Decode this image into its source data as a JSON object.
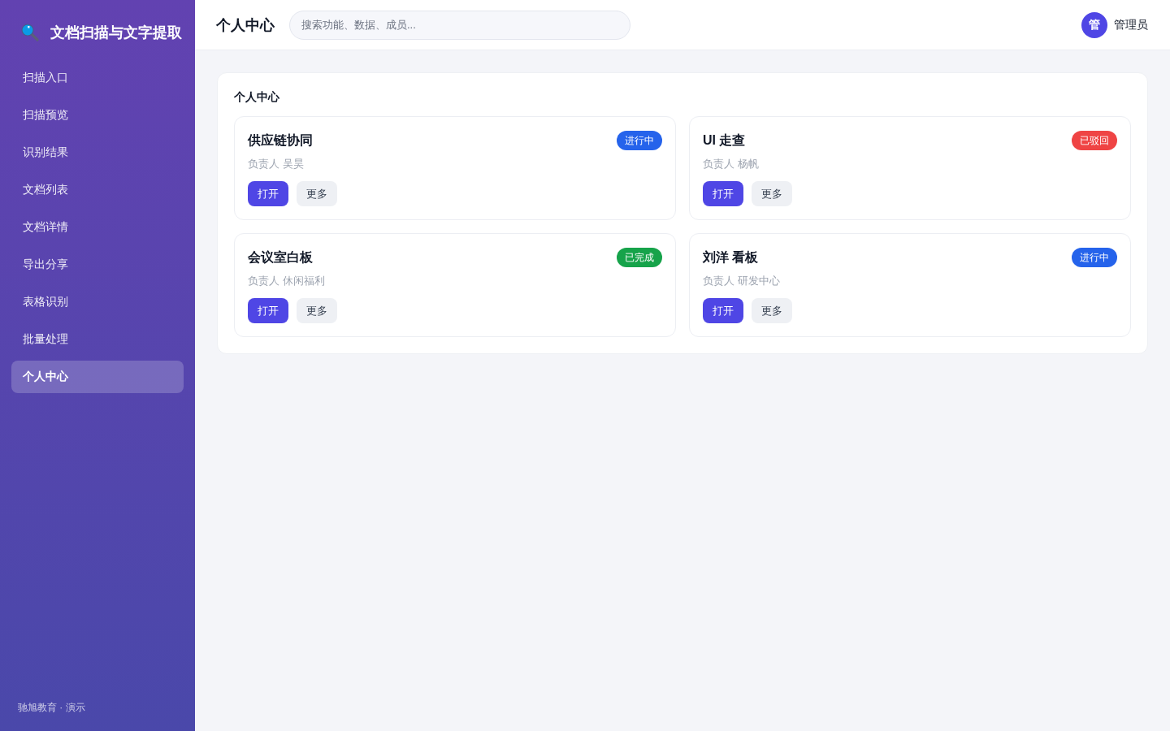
{
  "sidebar": {
    "logo_title": "文档扫描与文字提取",
    "items": [
      {
        "label": "扫描入口",
        "selected": false
      },
      {
        "label": "扫描预览",
        "selected": false
      },
      {
        "label": "识别结果",
        "selected": false
      },
      {
        "label": "文档列表",
        "selected": false
      },
      {
        "label": "文档详情",
        "selected": false
      },
      {
        "label": "导出分享",
        "selected": false
      },
      {
        "label": "表格识别",
        "selected": false
      },
      {
        "label": "批量处理",
        "selected": false
      },
      {
        "label": "个人中心",
        "selected": true
      }
    ],
    "footer": "驰旭教育 · 演示"
  },
  "header": {
    "title": "个人中心",
    "search": {
      "placeholder": "搜索功能、数据、成员..."
    },
    "user": {
      "avatar": "管",
      "name": "管理员"
    }
  },
  "panel": {
    "title": "个人中心",
    "cards": [
      {
        "title": "供应链协同",
        "status": {
          "label": "进行中",
          "color": "#2563eb"
        },
        "owner": "负责人 吴昊",
        "buttons": [
          {
            "label": "打开",
            "kind": "primary"
          },
          {
            "label": "更多",
            "kind": "secondary"
          }
        ]
      },
      {
        "title": "UI 走查",
        "status": {
          "label": "已驳回",
          "color": "#ef4444"
        },
        "owner": "负责人 杨帆",
        "buttons": [
          {
            "label": "打开",
            "kind": "primary"
          },
          {
            "label": "更多",
            "kind": "secondary"
          }
        ]
      },
      {
        "title": "会议室白板",
        "status": {
          "label": "已完成",
          "color": "#16a34a"
        },
        "owner": "负责人 休闲福利",
        "buttons": [
          {
            "label": "打开",
            "kind": "primary"
          },
          {
            "label": "更多",
            "kind": "secondary"
          }
        ]
      },
      {
        "title": "刘洋 看板",
        "status": {
          "label": "进行中",
          "color": "#2563eb"
        },
        "owner": "负责人 研发中心",
        "buttons": [
          {
            "label": "打开",
            "kind": "primary"
          },
          {
            "label": "更多",
            "kind": "secondary"
          }
        ]
      }
    ]
  }
}
